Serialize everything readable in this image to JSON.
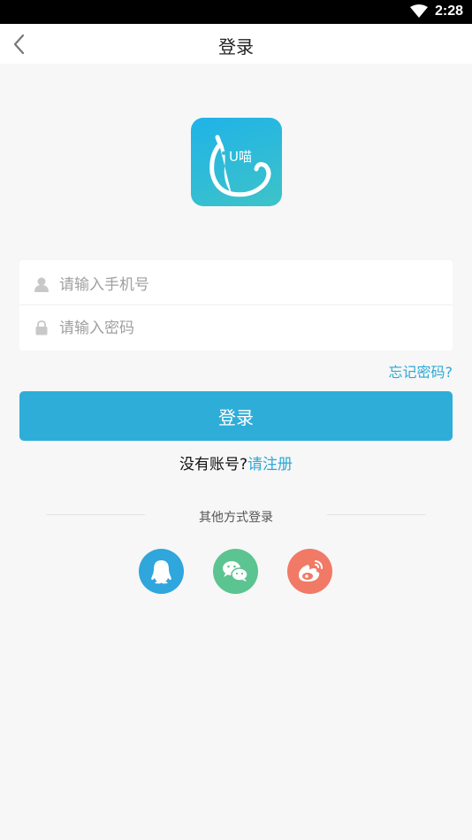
{
  "status_bar": {
    "time": "2:28"
  },
  "nav": {
    "title": "登录"
  },
  "logo": {
    "text": "U喵"
  },
  "form": {
    "phone_placeholder": "请输入手机号",
    "password_placeholder": "请输入密码"
  },
  "forgot_label": "忘记密码?",
  "login_button_label": "登录",
  "register": {
    "prompt": "没有账号?",
    "link": "请注册"
  },
  "other_login": {
    "label": "其他方式登录",
    "providers": [
      "qq-icon",
      "wechat-icon",
      "weibo-icon"
    ]
  },
  "colors": {
    "accent": "#2fadd9",
    "link": "#2baad7",
    "qq": "#2fa6dc",
    "wechat": "#5cc490",
    "weibo": "#f07a66"
  }
}
